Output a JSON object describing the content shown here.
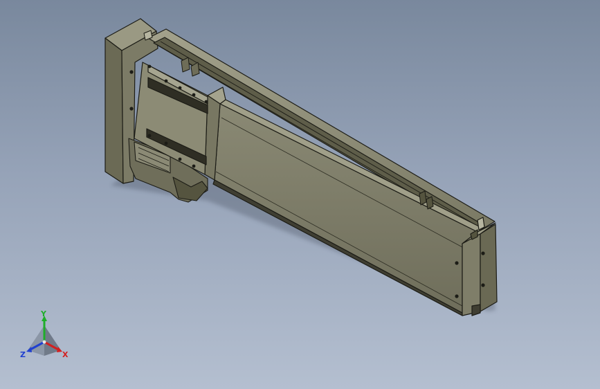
{
  "viewport": {
    "background_top": "#79889d",
    "background_bottom": "#b4bfd0",
    "model": "linear-actuator-assembly"
  },
  "model_colors": {
    "face_front": "#7d7c69",
    "face_top": "#8f8e79",
    "face_side": "#66654f",
    "face_dark": "#3f3e32",
    "edge": "#1c1c16"
  },
  "triad": {
    "x_label": "X",
    "y_label": "Y",
    "z_label": "Z",
    "x_color": "#d32020",
    "y_color": "#1fae2a",
    "z_color": "#2040d0"
  }
}
